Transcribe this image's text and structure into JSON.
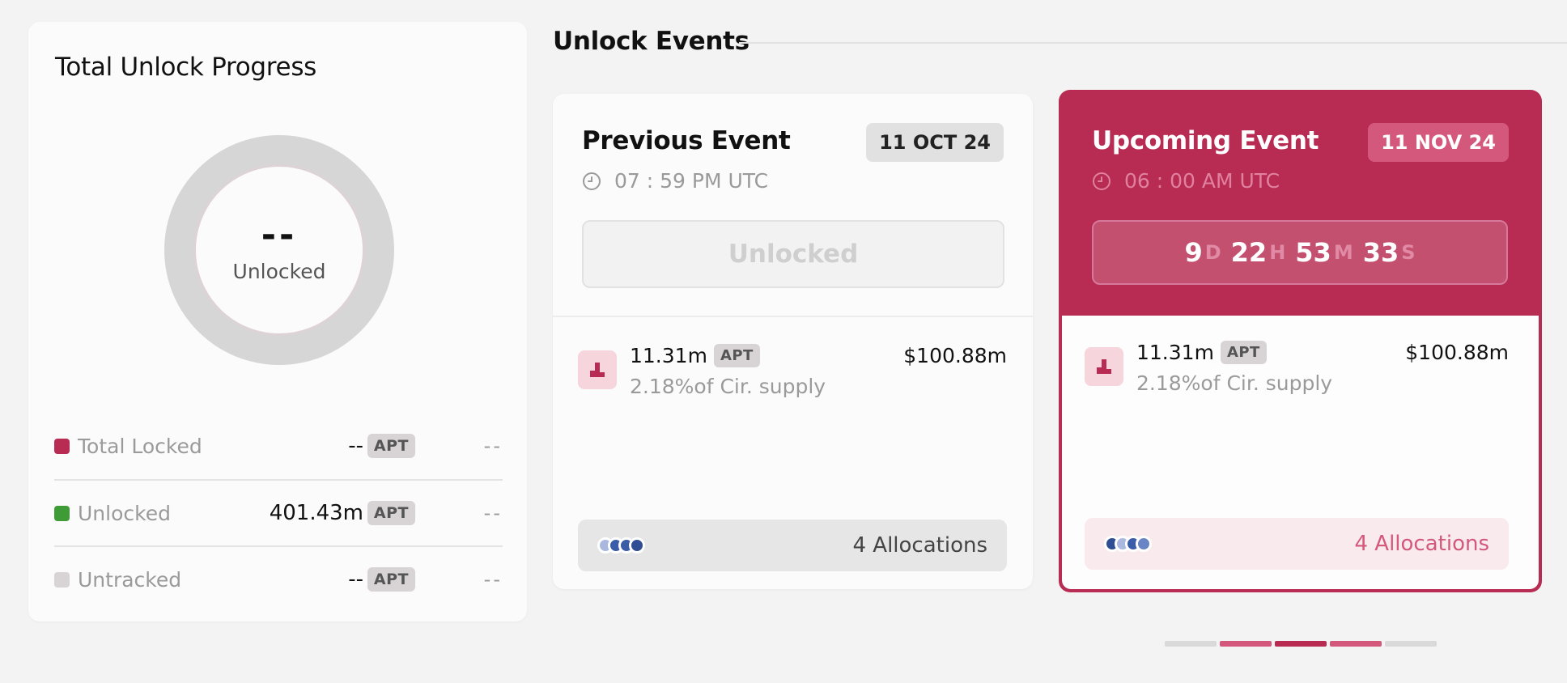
{
  "progress": {
    "title": "Total Unlock Progress",
    "center_value": "--",
    "center_label": "Unlocked",
    "legend": [
      {
        "name": "Total Locked",
        "amount": "--",
        "token": "APT",
        "extra": "--",
        "color": "#b82b53"
      },
      {
        "name": "Unlocked",
        "amount": "401.43m",
        "token": "APT",
        "extra": "--",
        "color": "#3e9b36"
      },
      {
        "name": "Untracked",
        "amount": "--",
        "token": "APT",
        "extra": "--",
        "color": "#d8d4d5"
      }
    ]
  },
  "events": {
    "title": "Unlock Events",
    "previous": {
      "title": "Previous Event",
      "date": "11 OCT 24",
      "time": "07 : 59 PM UTC",
      "status": "Unlocked",
      "amount": "11.31m",
      "token": "APT",
      "supply": "2.18%of Cir. supply",
      "usd": "$100.88m",
      "allocations_count": "4",
      "allocations_label": "Allocations"
    },
    "upcoming": {
      "title": "Upcoming Event",
      "date": "11 NOV 24",
      "time": "06 : 00 AM UTC",
      "countdown": {
        "d": "9",
        "d_unit": "D",
        "h": "22",
        "h_unit": "H",
        "m": "53",
        "m_unit": "M",
        "s": "33",
        "s_unit": "S"
      },
      "amount": "11.31m",
      "token": "APT",
      "supply": "2.18%of Cir. supply",
      "usd": "$100.88m",
      "allocations_count": "4",
      "allocations_label": "Allocations"
    }
  },
  "colors": {
    "accent": "#b82b53",
    "accent_soft": "#d3587c",
    "unlocked_green": "#3e9b36",
    "dot_light": "#aab8e0",
    "dot_mid": "#6a85c6",
    "dot_dark": "#2f4e93"
  },
  "icons": {
    "clock": "clock-icon",
    "token": "token-icon",
    "allocation_avatars": "allocation-avatars-icon"
  },
  "pager": {
    "count": 5,
    "active_index": 2
  }
}
